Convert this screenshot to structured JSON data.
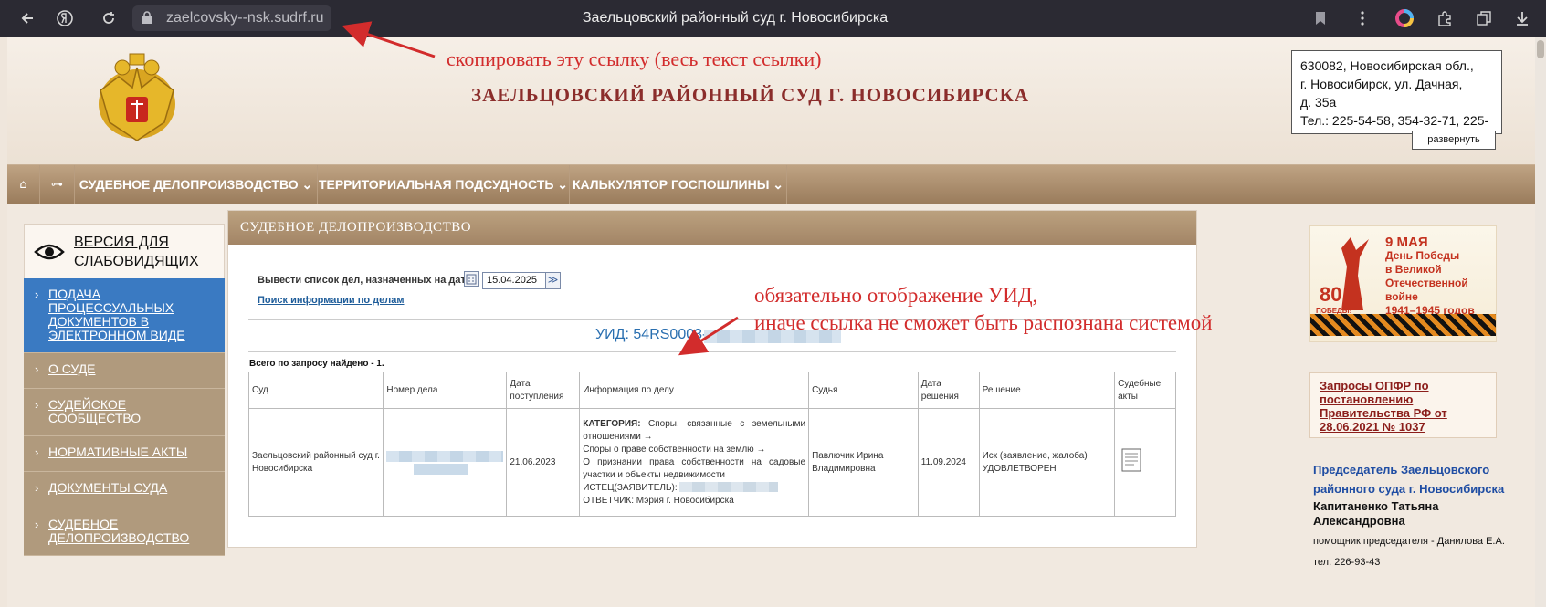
{
  "browser": {
    "url": "zaelcovsky--nsk.sudrf.ru",
    "tab_title": "Заельцовский районный суд г. Новосибирска",
    "icons": [
      "back-icon",
      "yandex-icon",
      "reload-icon",
      "lock-icon",
      "bookmark-icon",
      "menu-icon",
      "color-wheel-icon",
      "extensions-icon",
      "collections-icon",
      "download-icon"
    ]
  },
  "header": {
    "court_title": "ЗАЕЛЬЦОВСКИЙ РАЙОННЫЙ СУД Г. НОВОСИБИРСКА",
    "address_lines": [
      "630082, Новосибирская обл.,",
      "г. Новосибирск, ул. Дачная,",
      "д. 35а",
      "Тел.: 225-54-58, 354-32-71, 225-"
    ],
    "expand_label": "развернуть"
  },
  "nav": {
    "home_icon": "⌂",
    "sitemap_icon": "⊶",
    "items": [
      "СУДЕБНОЕ ДЕЛОПРОИЗВОДСТВО ⌄",
      "ТЕРРИТОРИАЛЬНАЯ ПОДСУДНОСТЬ ⌄",
      "КАЛЬКУЛЯТОР ГОСПОШЛИНЫ ⌄"
    ]
  },
  "sidebar": {
    "low_vision_line1": "ВЕРСИЯ ДЛЯ",
    "low_vision_line2": "СЛАБОВИДЯЩИХ",
    "chevron": "›",
    "items": [
      {
        "label": "ПОДАЧА ПРОЦЕССУАЛЬНЫХ ДОКУМЕНТОВ В ЭЛЕКТРОННОМ ВИДЕ"
      },
      {
        "label": "О СУДЕ"
      },
      {
        "label": "СУДЕЙСКОЕ СООБЩЕСТВО"
      },
      {
        "label": "НОРМАТИВНЫЕ АКТЫ"
      },
      {
        "label": "ДОКУМЕНТЫ СУДА"
      },
      {
        "label": "СУДЕБНОЕ ДЕЛОПРОИЗВОДСТВО"
      }
    ]
  },
  "main": {
    "title": "СУДЕБНОЕ ДЕЛОПРОИЗВОДСТВО",
    "date_label": "Вывести список дел, назначенных на дату",
    "date_value": "15.04.2025",
    "go_symbol": "≫",
    "search_link": "Поиск информации по делам",
    "uid_prefix": "УИД: 54RS0003-",
    "found_text": "Всего по запросу найдено - 1.",
    "columns": [
      "Суд",
      "Номер дела",
      "Дата поступления",
      "Информация по делу",
      "Судья",
      "Дата решения",
      "Решение",
      "Судебные акты"
    ],
    "row": {
      "court": "Заельцовский районный суд г. Новосибирска",
      "received": "21.06.2023",
      "category_label": "КАТЕГОРИЯ:",
      "category_text": "Споры, связанные с земельными отношениями →",
      "category_line2": "Споры о праве собственности на землю →",
      "category_line3": "О признании права собственности на садовые участки и объекты недвижимости",
      "plaintiff": "ИСТЕЦ(ЗАЯВИТЕЛЬ):",
      "defendant": "ОТВЕТЧИК: Мэрия г. Новосибирска",
      "judge": "Павлючик Ирина Владимировна",
      "decision_date": "11.09.2024",
      "decision_line1": "Иск (заявление, жалоба)",
      "decision_line2": "УДОВЛЕТВОРЕН"
    }
  },
  "right": {
    "banner_num": "80",
    "banner_pobedy": "ПОБЕДЫ!",
    "banner_lines": [
      "9 МАЯ",
      "День Победы",
      "в Великой",
      "Отечественной войне",
      "1941–1945 годов"
    ],
    "opfr": "Запросы ОПФР по постановлению Правительства РФ от 28.06.2021 № 1037",
    "chair_title": "Председатель Заельцовского районного суда г. Новосибирска",
    "chair_name": "Капитаненко Татьяна Александровна",
    "assistant": "помощник председателя - Данилова Е.А.",
    "tel": "тел. 226-93-43"
  },
  "annotations": {
    "note1": "скопировать эту ссылку (весь текст ссылки)",
    "note2_line1": "обязательно отображение УИД,",
    "note2_line2": "иначе ссылка не сможет быть распознана системой",
    "color": "#d22c2c"
  }
}
